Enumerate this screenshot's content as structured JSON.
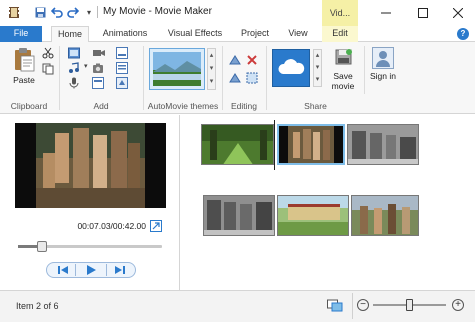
{
  "window": {
    "title": "My Movie - Movie Maker",
    "context_tab_title": "Vid..."
  },
  "tabs": [
    {
      "label": "File"
    },
    {
      "label": "Home"
    },
    {
      "label": "Animations"
    },
    {
      "label": "Visual Effects"
    },
    {
      "label": "Project"
    },
    {
      "label": "View"
    },
    {
      "label": "Edit"
    }
  ],
  "ribbon": {
    "clipboard": {
      "group_label": "Clipboard",
      "paste_label": "Paste"
    },
    "add": {
      "group_label": "Add"
    },
    "automovie": {
      "group_label": "AutoMovie themes"
    },
    "editing": {
      "group_label": "Editing"
    },
    "share": {
      "group_label": "Share",
      "save_movie_label": "Save movie",
      "sign_in_label": "Sign in"
    }
  },
  "preview": {
    "time": "00:07.03/00:42.00",
    "progress": 0.17
  },
  "status": {
    "item_text": "Item 2 of 6",
    "zoom": 0.5
  },
  "colors": {
    "accent": "#2a7acc",
    "context_tab": "#f5f0a6",
    "selection": "#7fbde8"
  }
}
